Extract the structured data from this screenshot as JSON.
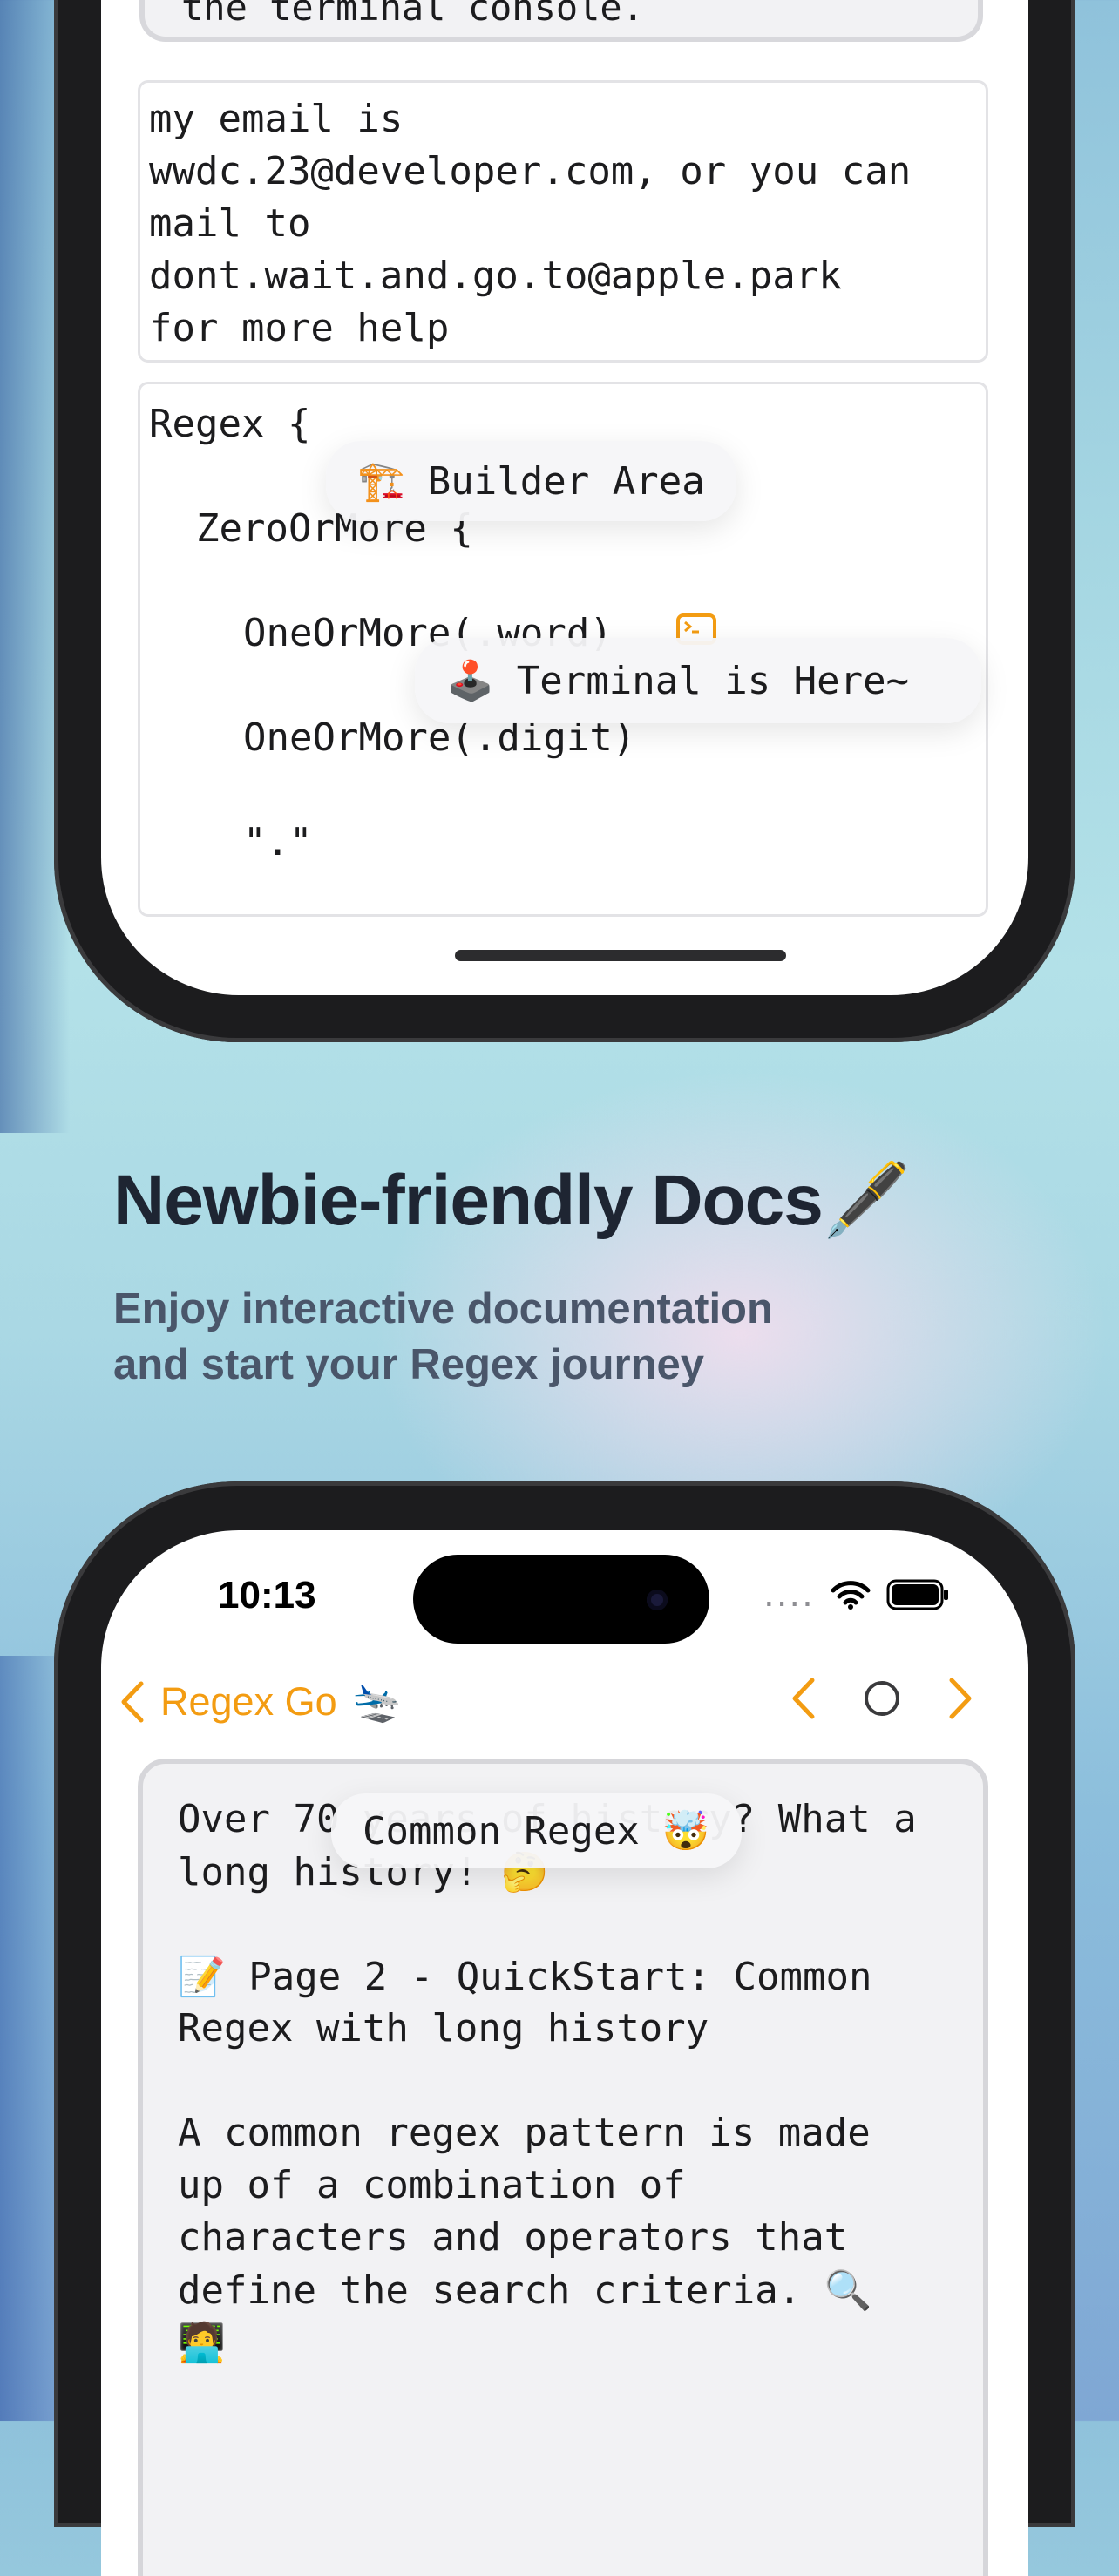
{
  "phone_top": {
    "prev_box_text": "the terminal console.",
    "email_text": "my email is\nwwdc.23@developer.com, or you can\nmail to\ndont.wait.and.go.to@apple.park\nfor more help",
    "code_lines": [
      "Regex {",
      "ZeroOrMore {",
      "OneOrMore(.word)",
      "OneOrMore(.digit)",
      "\".\""
    ],
    "builder_pill": {
      "emoji": "🏗️",
      "label": "Builder Area"
    },
    "terminal_pill": {
      "emoji": "🕹️",
      "label": "Terminal is Here~"
    },
    "terminal_icon": "terminal-icon"
  },
  "promo": {
    "title": "Newbie-friendly Docs",
    "title_emoji": "🖋️",
    "subtitle_line1": "Enjoy interactive documentation",
    "subtitle_line2": "and start your Regex journey"
  },
  "phone_bottom": {
    "status": {
      "time": "10:13",
      "signal_dots": "....",
      "wifi_icon": "wifi-icon",
      "battery_icon": "battery-icon"
    },
    "nav": {
      "back_label": "Regex Go",
      "back_emoji": "🛬",
      "prev_icon": "chevron-left-icon",
      "center_icon": "circle-icon",
      "next_icon": "chevron-right-icon"
    },
    "common_pill": {
      "label": "Common Regex",
      "emoji": "🤯"
    },
    "doc_lines": [
      "Over 70 years of history? What a",
      "long history! 🤔",
      "",
      "📝 Page 2 - QuickStart: Common",
      "Regex with long history",
      "",
      "A common regex pattern is made",
      "up of a combination of",
      "characters and operators that",
      "define the search criteria. 🔍",
      "🧑‍💻"
    ]
  },
  "colors": {
    "accent": "#f39c12",
    "headline": "#1e2532",
    "subtitle": "#4a566a"
  }
}
